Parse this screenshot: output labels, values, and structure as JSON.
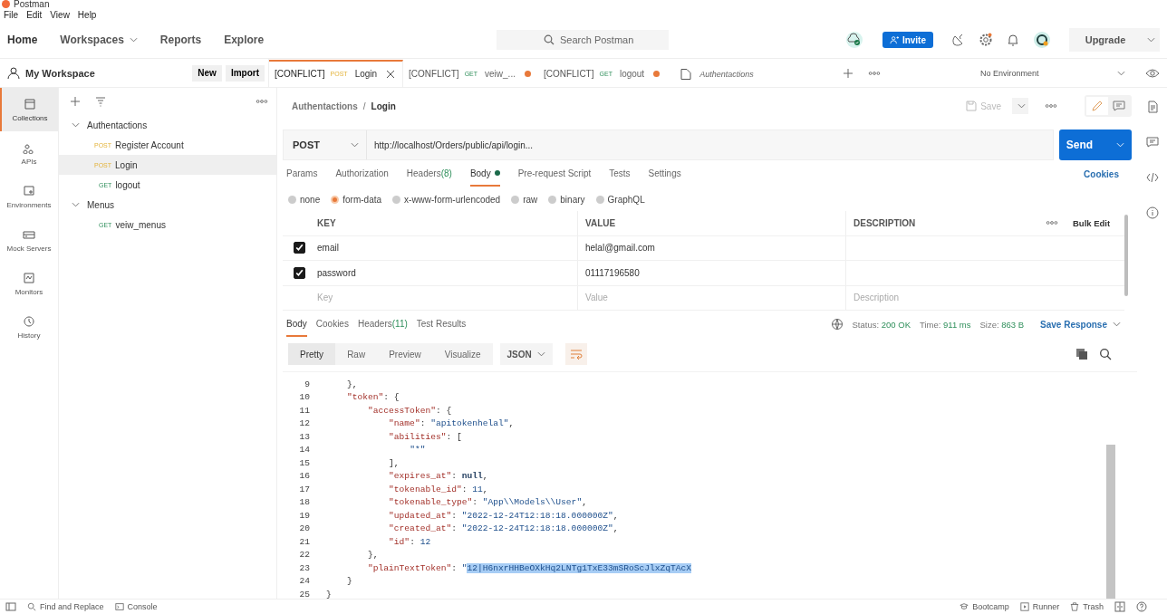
{
  "app_title": "Postman",
  "menu": [
    "File",
    "Edit",
    "View",
    "Help"
  ],
  "nav": [
    {
      "label": "Home",
      "caret": false
    },
    {
      "label": "Workspaces",
      "caret": true
    },
    {
      "label": "Reports",
      "caret": false
    },
    {
      "label": "Explore",
      "caret": false
    }
  ],
  "search": {
    "placeholder": "Search Postman"
  },
  "invite": "Invite",
  "upgrade": "Upgrade",
  "workspace": {
    "name": "My Workspace",
    "buttons": [
      "New",
      "Import"
    ]
  },
  "request_tabs": [
    {
      "kind": "request",
      "prefix": "[CONFLICT]",
      "method": "POST",
      "name": "Login",
      "selected": true,
      "unsaved": false
    },
    {
      "kind": "request",
      "prefix": "[CONFLICT]",
      "method": "GET",
      "name": "veiw_...",
      "selected": false,
      "unsaved": true
    },
    {
      "kind": "request",
      "prefix": "[CONFLICT]",
      "method": "GET",
      "name": "logout",
      "selected": false,
      "unsaved": true
    },
    {
      "kind": "folder",
      "name": "Authentactions",
      "selected": false,
      "unsaved": false
    }
  ],
  "environment": "No Environment",
  "rail": [
    {
      "label": "Collections",
      "selected": true
    },
    {
      "label": "APIs",
      "selected": false
    },
    {
      "label": "Environments",
      "selected": false
    },
    {
      "label": "Mock Servers",
      "selected": false
    },
    {
      "label": "Monitors",
      "selected": false
    },
    {
      "label": "History",
      "selected": false
    }
  ],
  "tree": [
    {
      "name": "Authentactions",
      "expanded": true,
      "children": [
        {
          "method": "POST",
          "name": "Register Account",
          "selected": false
        },
        {
          "method": "POST",
          "name": "Login",
          "selected": true
        },
        {
          "method": "GET",
          "name": "logout",
          "selected": false
        }
      ]
    },
    {
      "name": "Menus",
      "expanded": true,
      "children": [
        {
          "method": "GET",
          "name": "veiw_menus",
          "selected": false
        }
      ]
    }
  ],
  "breadcrumb": [
    "Authentactions",
    "Login"
  ],
  "breadcrumb_separator": "/",
  "save": "Save",
  "request": {
    "method": "POST",
    "url": "http://localhost/Orders/public/api/login...",
    "send": "Send"
  },
  "request_sections": [
    {
      "label": "Params",
      "selected": false,
      "dot": false
    },
    {
      "label": "Authorization",
      "selected": false,
      "dot": false
    },
    {
      "label": "Headers",
      "count": "(8)",
      "selected": false,
      "dot": false
    },
    {
      "label": "Body",
      "selected": true,
      "dot": true
    },
    {
      "label": "Pre-request Script",
      "selected": false,
      "dot": false
    },
    {
      "label": "Tests",
      "selected": false,
      "dot": false
    },
    {
      "label": "Settings",
      "selected": false,
      "dot": false
    }
  ],
  "cookies": "Cookies",
  "body_types": [
    {
      "label": "none",
      "selected": false
    },
    {
      "label": "form-data",
      "selected": true
    },
    {
      "label": "x-www-form-urlencoded",
      "selected": false
    },
    {
      "label": "raw",
      "selected": false
    },
    {
      "label": "binary",
      "selected": false
    },
    {
      "label": "GraphQL",
      "selected": false
    }
  ],
  "params": {
    "columns": [
      "KEY",
      "VALUE",
      "DESCRIPTION"
    ],
    "bulk_edit": "Bulk Edit",
    "rows": [
      {
        "key": "email",
        "value": "helal@gmail.com",
        "checked": true
      },
      {
        "key": "password",
        "value": "01117196580",
        "checked": true
      }
    ],
    "placeholders": [
      "Key",
      "Value",
      "Description"
    ]
  },
  "response_tabs": [
    {
      "label": "Body",
      "selected": true
    },
    {
      "label": "Cookies",
      "selected": false
    },
    {
      "label": "Headers",
      "count": "(11)",
      "selected": false
    },
    {
      "label": "Test Results",
      "selected": false
    }
  ],
  "status": [
    {
      "label": "Status:",
      "value": "200 OK"
    },
    {
      "label": "Time:",
      "value": "911 ms"
    },
    {
      "label": "Size:",
      "value": "863 B"
    }
  ],
  "save_response": "Save Response",
  "view_modes": [
    {
      "label": "Pretty",
      "selected": true
    },
    {
      "label": "Raw",
      "selected": false
    },
    {
      "label": "Preview",
      "selected": false
    },
    {
      "label": "Visualize",
      "selected": false
    }
  ],
  "format": "JSON",
  "code": [
    {
      "n": "9",
      "text": "    },"
    },
    {
      "n": "10",
      "text": "    \"token\": {"
    },
    {
      "n": "11",
      "text": "        \"accessToken\": {"
    },
    {
      "n": "12",
      "text": "            \"name\": \"apitokenhelal\","
    },
    {
      "n": "13",
      "text": "            \"abilities\": ["
    },
    {
      "n": "14",
      "text": "                \"*\""
    },
    {
      "n": "15",
      "text": "            ],"
    },
    {
      "n": "16",
      "text": "            \"expires_at\": null,"
    },
    {
      "n": "17",
      "text": "            \"tokenable_id\": 11,"
    },
    {
      "n": "18",
      "text": "            \"tokenable_type\": \"App\\\\Models\\\\User\","
    },
    {
      "n": "19",
      "text": "            \"updated_at\": \"2022-12-24T12:18:18.000000Z\","
    },
    {
      "n": "20",
      "text": "            \"created_at\": \"2022-12-24T12:18:18.000000Z\","
    },
    {
      "n": "21",
      "text": "            \"id\": 12"
    },
    {
      "n": "22",
      "text": "        },"
    },
    {
      "n": "23",
      "text": "        \"plainTextToken\": \"",
      "selected_text": "12|H6nxrHHBeOXkHq2LNTg1TxE33mSRoScJlxZqTAcX"
    },
    {
      "n": "24",
      "text": "    }"
    },
    {
      "n": "25",
      "text": "}"
    }
  ],
  "footer_left": [
    "Find and Replace",
    "Console"
  ],
  "footer_right": [
    "Bootcamp",
    "Runner",
    "Trash"
  ]
}
